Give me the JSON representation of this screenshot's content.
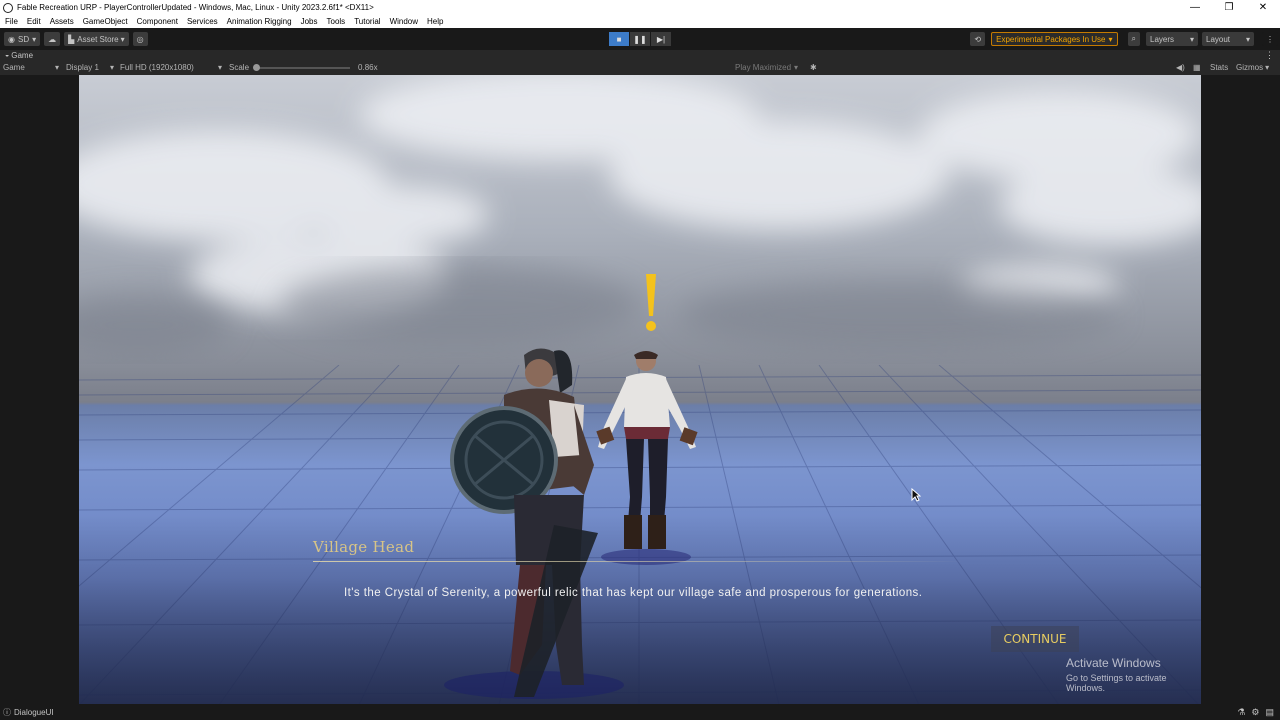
{
  "window": {
    "title": "Fable Recreation URP - PlayerControllerUpdated - Windows, Mac, Linux - Unity 2023.2.6f1* <DX11>",
    "controls": [
      "—",
      "❐",
      "✕"
    ]
  },
  "menu": [
    "File",
    "Edit",
    "Assets",
    "GameObject",
    "Component",
    "Services",
    "Animation Rigging",
    "Jobs",
    "Tools",
    "Tutorial",
    "Window",
    "Help"
  ],
  "toolbar": {
    "account": "SD",
    "asset_store": "Asset Store",
    "experimental": "Experimental Packages In Use",
    "layers": "Layers",
    "layout": "Layout"
  },
  "tab": {
    "label": "Game"
  },
  "gamebar": {
    "mode": "Game",
    "display": "Display 1",
    "resolution": "Full HD (1920x1080)",
    "scale_label": "Scale",
    "scale_value": "0.86x",
    "play_mode": "Play Maximized",
    "stats": "Stats",
    "gizmos": "Gizmos"
  },
  "dialogue": {
    "speaker": "Village Head",
    "text": "It's the Crystal of Serenity, a powerful relic that has kept our village safe and prosperous for generations.",
    "continue": "CONTINUE"
  },
  "watermark": {
    "line1": "Activate Windows",
    "line2": "Go to Settings to activate Windows."
  },
  "status": {
    "label": "DialogueUI"
  },
  "colors": {
    "accent": "#3d7cc9",
    "warning": "#f3a400",
    "speaker": "#d7c487",
    "continue": "#e8cd61"
  }
}
